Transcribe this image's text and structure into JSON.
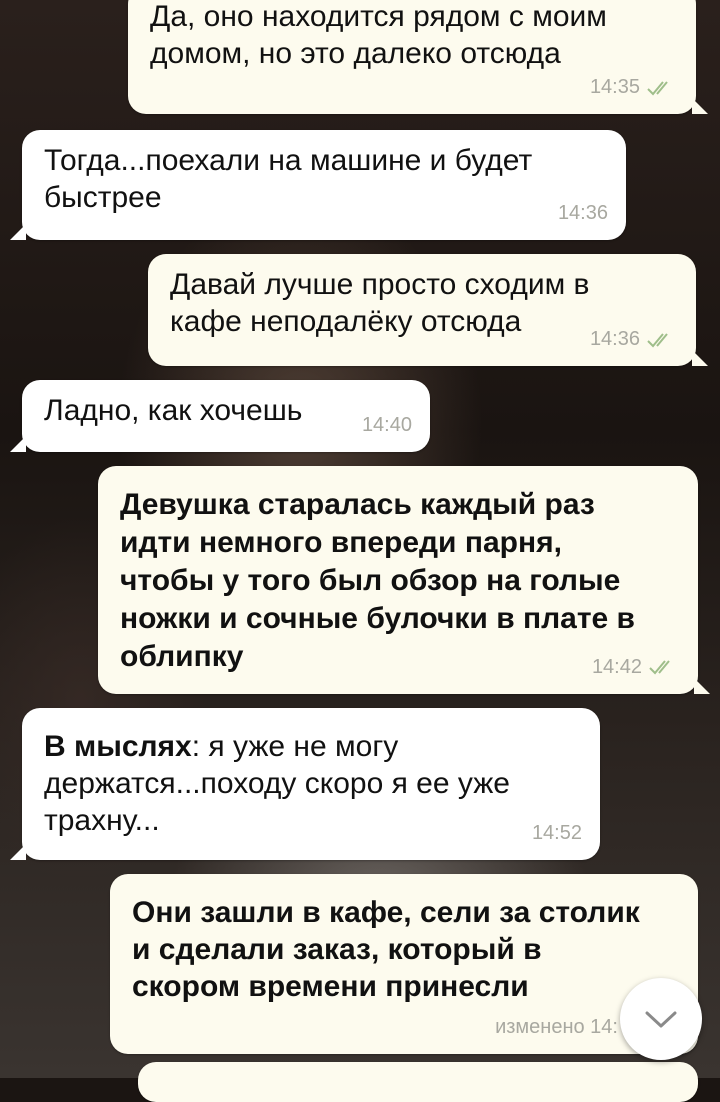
{
  "messages": [
    {
      "id": "m1",
      "dir": "out",
      "text": "Да, оно находится рядом с моим\nдомом, но это далеко отсюда",
      "time": "14:35",
      "read": true
    },
    {
      "id": "m2",
      "dir": "in",
      "text": "Тогда...поехали на машине и будет\nбыстрее",
      "time": "14:36"
    },
    {
      "id": "m3",
      "dir": "out",
      "text": "Давай лучше просто сходим в\nкафе неподалёку отсюда",
      "time": "14:36",
      "read": true
    },
    {
      "id": "m4",
      "dir": "in",
      "text": "Ладно, как хочешь",
      "time": "14:40"
    },
    {
      "id": "m5",
      "dir": "out",
      "text": "Девушка старалась каждый раз\nидти немного впереди парня,\nчтобы у того был обзор на голые\nножки и сочные булочки в плате в\nоблипку",
      "time": "14:42",
      "read": true
    },
    {
      "id": "m6",
      "dir": "in",
      "bold_prefix": "В мыслях",
      "text": ": я уже не могу\nдержатся...походу скоро я ее уже\nтрахну...",
      "time": "14:52"
    },
    {
      "id": "m7",
      "dir": "out",
      "text": "Они зашли в кафе, сели за столик\nи сделали заказ, который в\nскором времени принесли",
      "time": "изменено 14:"
    }
  ],
  "colors": {
    "check": "#9fbe8a",
    "bubble_out": "#fdfbee",
    "bubble_in": "#ffffff"
  },
  "icons": {
    "scroll_down": "chevron-down-icon",
    "read_status": "double-check-icon"
  }
}
